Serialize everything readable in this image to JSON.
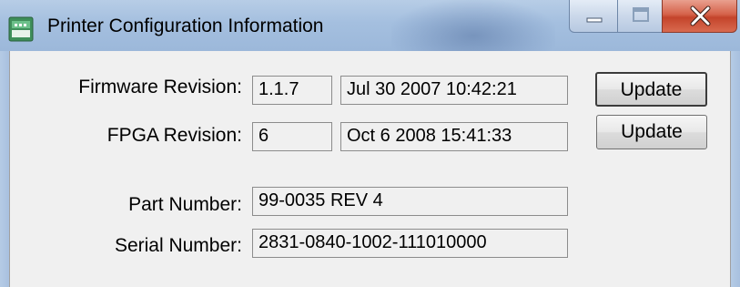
{
  "window": {
    "title": "Printer Configuration Information"
  },
  "firmware": {
    "label": "Firmware Revision:",
    "version": "1.1.7",
    "date": "Jul 30 2007 10:42:21",
    "button_label": "Update"
  },
  "fpga": {
    "label": "FPGA Revision:",
    "version": "6",
    "date": "Oct 6 2008 15:41:33",
    "button_label": "Update"
  },
  "part_number": {
    "label": "Part Number:",
    "value": "99-0035 REV 4"
  },
  "serial_number": {
    "label": "Serial Number:",
    "value": "2831-0840-1002-111010000"
  },
  "icons": {
    "app": "printer-app-icon",
    "minimize": "minimize-icon",
    "maximize": "maximize-icon",
    "close": "close-icon"
  }
}
